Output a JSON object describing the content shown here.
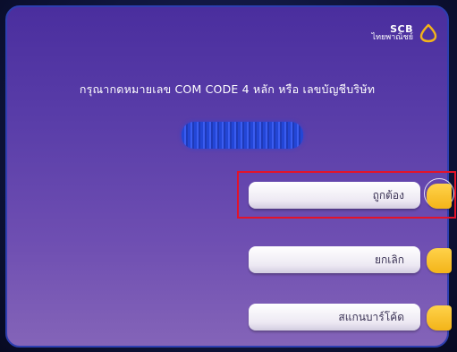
{
  "brand": {
    "name": "SCB",
    "sub": "ไทยพาณิชย์",
    "accent": "#f3b419"
  },
  "prompt": {
    "text": "กรุณากดหมายเลข COM CODE 4 หลัก หรือ เลขบัญชีบริษัท"
  },
  "code_field": {
    "state": "masked"
  },
  "buttons": [
    {
      "label": "ถูกต้อง",
      "highlighted": true
    },
    {
      "label": "ยกเลิก",
      "highlighted": false
    },
    {
      "label": "สแกนบาร์โค้ด",
      "highlighted": false
    }
  ],
  "colors": {
    "screen_top": "#4a2e9e",
    "screen_bottom": "#8464b8",
    "highlight": "#e3132a",
    "tab": "#f3b419"
  }
}
